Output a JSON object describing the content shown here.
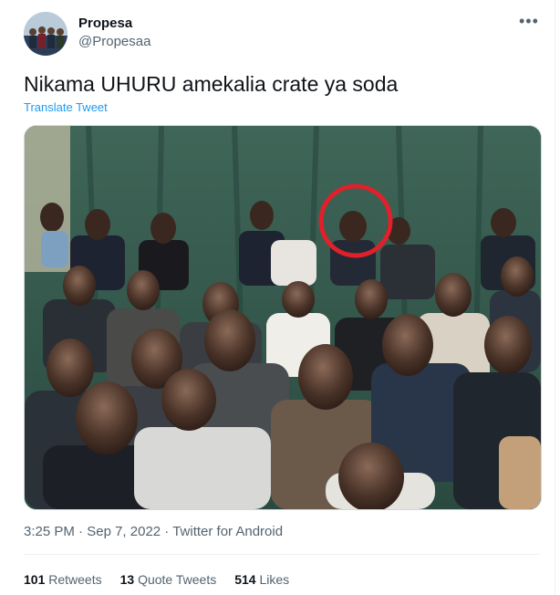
{
  "author": {
    "display_name": "Propesa",
    "handle": "@Propesaa"
  },
  "menu_icon": "more-horizontal-icon",
  "tweet": {
    "text": "Nikama UHURU amekalia crate ya soda",
    "translate_label": "Translate Tweet"
  },
  "meta": {
    "time": "3:25 PM",
    "separator1": " · ",
    "date": "Sep 7, 2022",
    "separator2": " · ",
    "source": "Twitter for Android"
  },
  "stats": {
    "retweets_count": "101",
    "retweets_label": "Retweets",
    "quotes_count": "13",
    "quotes_label": "Quote Tweets",
    "likes_count": "514",
    "likes_label": "Likes"
  },
  "colors": {
    "link": "#1d9bf0",
    "secondary_text": "#536471",
    "highlight_circle": "#e0202a"
  }
}
